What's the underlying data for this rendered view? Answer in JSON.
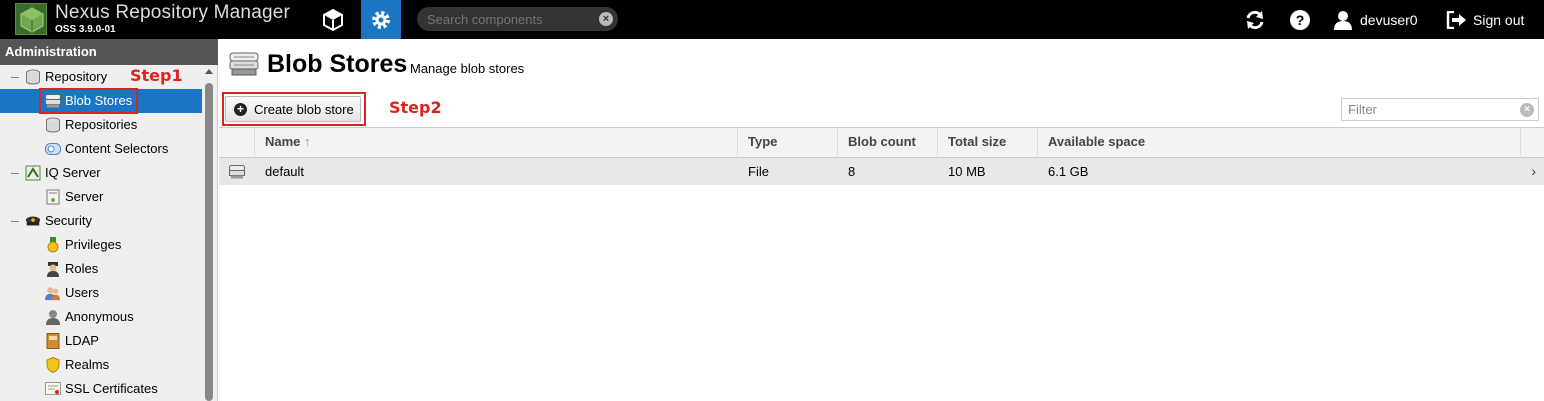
{
  "header": {
    "app_title": "Nexus Repository Manager",
    "version": "OSS 3.9.0-01",
    "search_placeholder": "Search components",
    "user_name": "devuser0",
    "signout_label": "Sign out",
    "colors": {
      "background": "#000000",
      "active_tab": "#1a75c4"
    }
  },
  "sidebar": {
    "title": "Administration",
    "items": [
      {
        "label": "Repository",
        "icon": "database-icon",
        "level": 0
      },
      {
        "label": "Blob Stores",
        "icon": "blob-store-icon",
        "level": 1,
        "selected": true
      },
      {
        "label": "Repositories",
        "icon": "database-icon",
        "level": 1
      },
      {
        "label": "Content Selectors",
        "icon": "content-selector-icon",
        "level": 1
      },
      {
        "label": "IQ Server",
        "icon": "iq-server-icon",
        "level": 0
      },
      {
        "label": "Server",
        "icon": "server-icon",
        "level": 1
      },
      {
        "label": "Security",
        "icon": "police-hat-icon",
        "level": 0
      },
      {
        "label": "Privileges",
        "icon": "medal-icon",
        "level": 1
      },
      {
        "label": "Roles",
        "icon": "officer-icon",
        "level": 1
      },
      {
        "label": "Users",
        "icon": "users-icon",
        "level": 1
      },
      {
        "label": "Anonymous",
        "icon": "anonymous-user-icon",
        "level": 1
      },
      {
        "label": "LDAP",
        "icon": "address-book-icon",
        "level": 1
      },
      {
        "label": "Realms",
        "icon": "shield-icon",
        "level": 1
      },
      {
        "label": "SSL Certificates",
        "icon": "certificate-icon",
        "level": 1
      }
    ]
  },
  "annotations": {
    "step1": "Step1",
    "step2": "Step2",
    "color": "#dd2222"
  },
  "main": {
    "title": "Blob Stores",
    "subtitle": "Manage blob stores",
    "create_button": "Create blob store",
    "filter_placeholder": "Filter",
    "columns": [
      "Name",
      "Type",
      "Blob count",
      "Total size",
      "Available space"
    ],
    "sort_indicator": "↑",
    "rows": [
      {
        "name": "default",
        "type": "File",
        "blob_count": "8",
        "total_size": "10 MB",
        "available_space": "6.1 GB"
      }
    ]
  }
}
